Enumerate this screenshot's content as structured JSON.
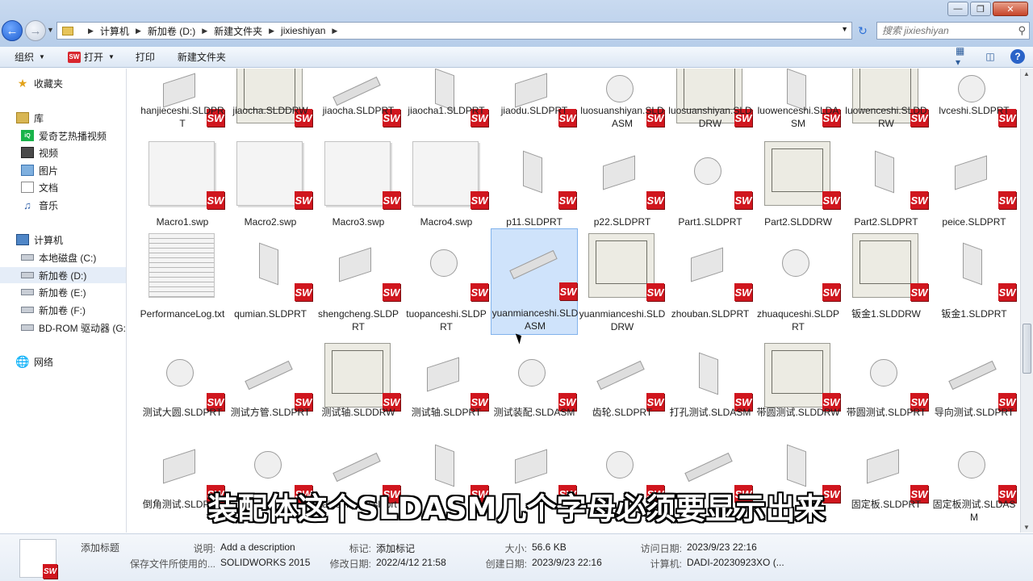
{
  "window": {
    "controls": [
      "—",
      "❐",
      "✕"
    ]
  },
  "address": {
    "crumbs": [
      "计算机",
      "新加卷 (D:)",
      "新建文件夹",
      "jixieshiyan"
    ]
  },
  "search": {
    "placeholder": "搜索 jixieshiyan"
  },
  "toolbar": {
    "organize": "组织",
    "open": "打开",
    "print": "打印",
    "new_folder": "新建文件夹"
  },
  "sidebar": {
    "favorites": "收藏夹",
    "libraries": "库",
    "lib_items": [
      "爱奇艺热播视频",
      "视频",
      "图片",
      "文档",
      "音乐"
    ],
    "computer": "计算机",
    "drives": [
      "本地磁盘 (C:)",
      "新加卷 (D:)",
      "新加卷 (E:)",
      "新加卷 (F:)",
      "BD-ROM 驱动器 (G:"
    ],
    "network": "网络"
  },
  "files": [
    [
      "hanjieceshi.SLDPRT",
      "jiaocha.SLDDRW",
      "jiaocha.SLDPRT",
      "jiaocha1.SLDPRT",
      "jiaodu.SLDPRT",
      "luosuanshiyan.SLDASM",
      "luosuanshiyan.SLDDRW",
      "luowenceshi.SLDASM",
      "luowenceshi.SLDDRW",
      "lvceshi.SLDPRT"
    ],
    [
      "Macro1.swp",
      "Macro2.swp",
      "Macro3.swp",
      "Macro4.swp",
      "p11.SLDPRT",
      "p22.SLDPRT",
      "Part1.SLDPRT",
      "Part2.SLDDRW",
      "Part2.SLDPRT",
      "peice.SLDPRT"
    ],
    [
      "PerformanceLog.txt",
      "qumian.SLDPRT",
      "shengcheng.SLDPRT",
      "tuopanceshi.SLDPRT",
      "yuanmianceshi.SLDASM",
      "yuanmianceshi.SLDDRW",
      "zhouban.SLDPRT",
      "zhuaquceshi.SLDPRT",
      "钣金1.SLDDRW",
      "钣金1.SLDPRT"
    ],
    [
      "测试大圆.SLDPRT",
      "测试方管.SLDPRT",
      "测试轴.SLDDRW",
      "测试轴.SLDPRT",
      "测试装配.SLDASM",
      "齿轮.SLDPRT",
      "打孔测试.SLDASM",
      "带圆测试.SLDDRW",
      "带圆测试.SLDPRT",
      "导向测试.SLDPRT"
    ],
    [
      "倒角测试.SLDPRT",
      "",
      "taigoufang0.sldprt",
      "",
      "",
      "",
      "",
      "",
      "固定板.SLDPRT",
      "固定板测试.SLDASM"
    ]
  ],
  "details": {
    "title_label": "添加标题",
    "desc_key": "说明:",
    "desc_val": "Add a description",
    "saved_key": "保存文件所使用的...",
    "saved_val": "SOLIDWORKS 2015",
    "tag_key": "标记:",
    "tag_val": "添加标记",
    "modified_key": "修改日期:",
    "modified_val": "2022/4/12 21:58",
    "size_key": "大小:",
    "size_val": "56.6 KB",
    "created_key": "创建日期:",
    "created_val": "2023/9/23 22:16",
    "accessed_key": "访问日期:",
    "accessed_val": "2023/9/23 22:16",
    "computer_key": "计算机:",
    "computer_val": "DADI-20230923XO (..."
  },
  "subtitle": "装配体这个SLDASM几个字母必须要显示出来",
  "colors": {
    "sw_red": "#d0161e",
    "selection": "#cfe3fb",
    "chrome": "#c9daf0"
  }
}
